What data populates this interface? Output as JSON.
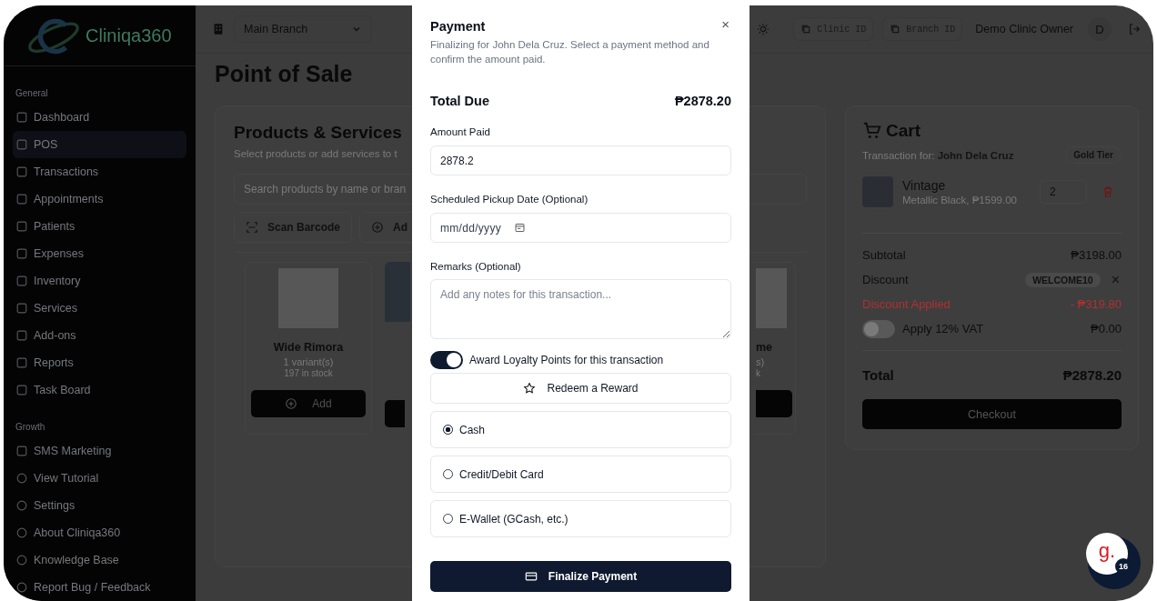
{
  "sidebar": {
    "logo": "Cliniqa360",
    "sections": [
      {
        "title": "General",
        "items": [
          {
            "label": "Dashboard",
            "selected": false
          },
          {
            "label": "POS",
            "selected": true
          },
          {
            "label": "Transactions",
            "selected": false
          },
          {
            "label": "Appointments",
            "selected": false
          },
          {
            "label": "Patients",
            "selected": false
          },
          {
            "label": "Expenses",
            "selected": false
          },
          {
            "label": "Inventory",
            "selected": false
          },
          {
            "label": "Services",
            "selected": false
          },
          {
            "label": "Add-ons",
            "selected": false
          },
          {
            "label": "Reports",
            "selected": false
          },
          {
            "label": "Task Board",
            "selected": false
          }
        ]
      },
      {
        "title": "Growth",
        "items": [
          {
            "label": "SMS Marketing",
            "selected": false
          }
        ]
      }
    ],
    "footer_items": [
      "View Tutorial",
      "Settings",
      "About Cliniqa360",
      "Knowledge Base",
      "Report Bug / Feedback"
    ]
  },
  "topbar": {
    "branch_select": "Main Branch",
    "clinic_id": "Clinic ID",
    "branch_id": "Branch ID",
    "user_name": "Demo Clinic Owner",
    "avatar": "D"
  },
  "page_title": "Point of Sale",
  "products": {
    "title": "Products & Services",
    "subtitle": "Select products or add services to t",
    "search_placeholder": "Search products by name or bran",
    "buttons": [
      "Scan Barcode",
      "Ad"
    ],
    "cards": [
      {
        "kind": "full",
        "name": "Wide Rimora",
        "variants": "1 variant(s)",
        "stock": "197 in stock",
        "button": "Add"
      },
      {
        "kind": "covered"
      },
      {
        "kind": "fragment",
        "name": "me",
        "variants": "s)",
        "stock": "k"
      }
    ]
  },
  "cart": {
    "title": "Cart",
    "customer": "Transaction for: **John Dela Cruz**",
    "tier": "Gold Tier",
    "items": [
      {
        "name": "Vintage",
        "detail": "Metallic Black, ₱1599.00",
        "quantity": "2"
      }
    ],
    "subtotal_label": "Subtotal",
    "subtotal": "₱3198.00",
    "discount_label": "Discount",
    "discount_code": "WELCOME10",
    "remove": "×",
    "discount_applied_label": "Discount Applied",
    "discount_applied": "- ₱319.80",
    "vat": {
      "label": "Apply 12% VAT",
      "on": false,
      "value": "₱0.00"
    },
    "total_label": "Total",
    "total": "₱2878.20",
    "checkout": "Checkout"
  },
  "payment_modal": {
    "title": "Payment",
    "close": "×",
    "description": "Finalizing for John Dela Cruz. Select a payment method and confirm the amount paid.",
    "total_due_label": "Total Due",
    "total_due": "₱2878.20",
    "amount_label": "Amount Paid",
    "amount_value": "2878.2",
    "pickup_label": "Scheduled Pickup Date (Optional)",
    "pickup_placeholder": "mm/dd/yyyy",
    "remarks_label": "Remarks (Optional)",
    "remarks_placeholder": "Add any notes for this transaction...",
    "loyalty": {
      "label": "Award Loyalty Points for this transaction",
      "on": true
    },
    "redeem": "Redeem a Reward",
    "methods": [
      {
        "label": "Cash",
        "selected": true
      },
      {
        "label": "Credit/Debit Card",
        "selected": false
      },
      {
        "label": "E-Wallet (GCash, etc.)",
        "selected": false
      }
    ],
    "finalize": "Finalize Payment"
  },
  "chat_widget": {
    "logo": "g.",
    "badge": "16"
  }
}
